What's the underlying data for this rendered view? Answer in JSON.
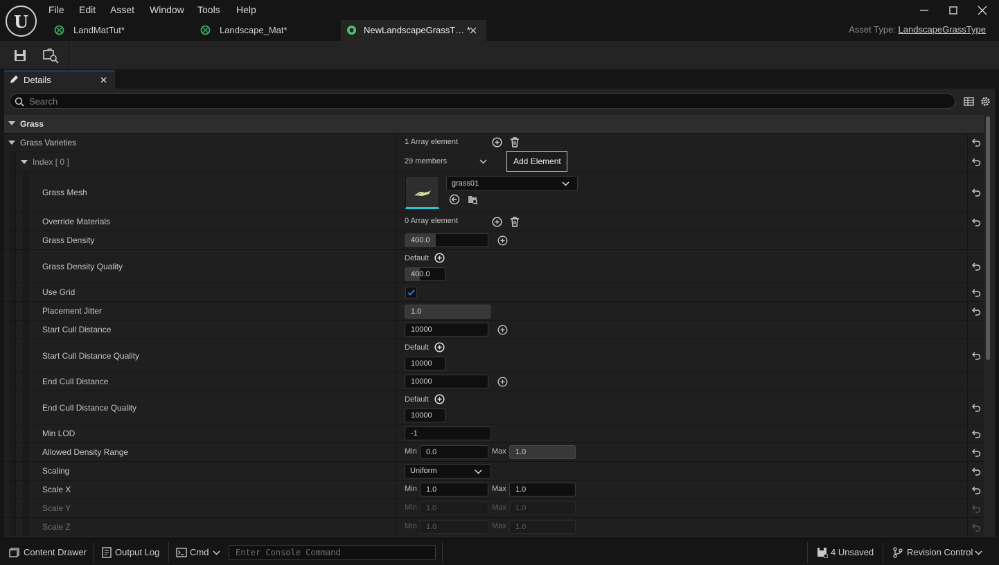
{
  "app": {
    "logo_label": "U"
  },
  "menu": [
    "File",
    "Edit",
    "Asset",
    "Window",
    "Tools",
    "Help"
  ],
  "tabs": [
    {
      "label": "LandMatTut*"
    },
    {
      "label": "Landscape_Mat*"
    },
    {
      "label": "NewLandscapeGrassT… *"
    }
  ],
  "asset_type": {
    "label": "Asset Type:",
    "value": "LandscapeGrassType"
  },
  "details_tab": {
    "label": "Details"
  },
  "search": {
    "placeholder": "Search"
  },
  "category": {
    "label": "Grass"
  },
  "tooltip": "Add Element",
  "rows": {
    "grass_varieties": {
      "name": "Grass Varieties",
      "value": "1 Array element"
    },
    "index0": {
      "name": "Index [ 0 ]",
      "value": "29 members"
    },
    "grass_mesh": {
      "name": "Grass Mesh",
      "value": "grass01"
    },
    "override_materials": {
      "name": "Override Materials",
      "value": "0 Array element"
    },
    "grass_density": {
      "name": "Grass Density",
      "value": "400.0"
    },
    "grass_density_quality": {
      "name": "Grass Density Quality",
      "default": "Default",
      "value": "400.0"
    },
    "use_grid": {
      "name": "Use Grid",
      "checked": true
    },
    "placement_jitter": {
      "name": "Placement Jitter",
      "value": "1.0"
    },
    "start_cull": {
      "name": "Start Cull Distance",
      "value": "10000"
    },
    "start_cull_quality": {
      "name": "Start Cull Distance Quality",
      "default": "Default",
      "value": "10000"
    },
    "end_cull": {
      "name": "End Cull Distance",
      "value": "10000"
    },
    "end_cull_quality": {
      "name": "End Cull Distance Quality",
      "default": "Default",
      "value": "10000"
    },
    "min_lod": {
      "name": "Min LOD",
      "value": "-1"
    },
    "allowed_density": {
      "name": "Allowed Density Range",
      "min_label": "Min",
      "min": "0.0",
      "max_label": "Max",
      "max": "1.0"
    },
    "scaling": {
      "name": "Scaling",
      "value": "Uniform"
    },
    "scale_x": {
      "name": "Scale X",
      "min_label": "Min",
      "min": "1.0",
      "max_label": "Max",
      "max": "1.0"
    },
    "scale_y": {
      "name": "Scale Y",
      "min_label": "Min",
      "min": "1.0",
      "max_label": "Max",
      "max": "1.0"
    },
    "scale_z": {
      "name": "Scale Z",
      "min_label": "Min",
      "min": "1.0",
      "max_label": "Max",
      "max": "1.0"
    }
  },
  "statusbar": {
    "content_drawer": "Content Drawer",
    "output_log": "Output Log",
    "cmd": "Cmd",
    "console_placeholder": "Enter Console Command",
    "unsaved": "4 Unsaved",
    "revision_control": "Revision Control"
  },
  "colors": {
    "accent": "#2b6ed8",
    "grass_icon": "#33b05a",
    "active_tab_icon": "#4cc26e",
    "check": "#2b6ed8"
  }
}
